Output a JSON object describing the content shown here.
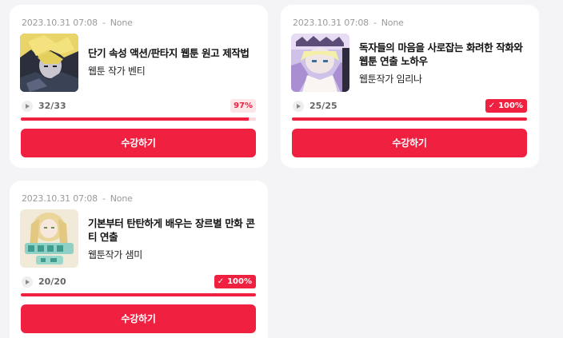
{
  "cards": [
    {
      "date": "2023.10.31 07:08",
      "separator": "-",
      "status": "None",
      "title": "단기 속성 액션/판타지 웹툰 원고 제작법",
      "author": "웹툰 작가 벤티",
      "progress_text": "32/33",
      "progress_badge": "97%",
      "progress_fraction": 0.97,
      "button_label": "수강하기",
      "thumbnail_icon": "manga-thumbnail-blonde-character"
    },
    {
      "date": "2023.10.31 07:08",
      "separator": "-",
      "status": "None",
      "title": "독자들의 마음을 사로잡는 화려한 작화와 웹툰 연출 노하우",
      "author": "웹툰작가 임리나",
      "progress_text": "25/25",
      "progress_badge": "100%",
      "progress_fraction": 1.0,
      "button_label": "수강하기",
      "thumbnail_icon": "manga-thumbnail-crowned-character"
    },
    {
      "date": "2023.10.31 07:08",
      "separator": "-",
      "status": "None",
      "title": "기본부터 탄탄하게 배우는 장르별 만화 콘티 연출",
      "author": "웹툰작가 샘미",
      "progress_text": "20/20",
      "progress_badge": "100%",
      "progress_fraction": 1.0,
      "button_label": "수강하기",
      "thumbnail_icon": "manga-thumbnail-princess-cover"
    }
  ],
  "colors": {
    "accent": "#ef2040",
    "accent_light": "#fde6ea",
    "page_bg": "#f4f4f6"
  },
  "icons": {
    "play": "play-icon",
    "check": "check-icon"
  }
}
